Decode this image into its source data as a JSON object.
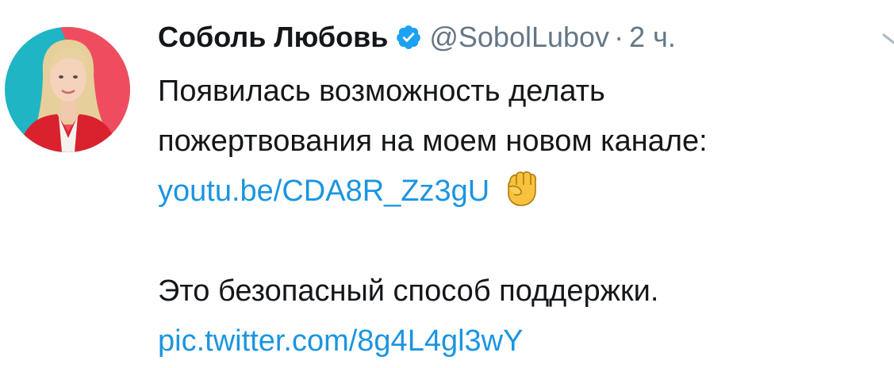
{
  "tweet": {
    "display_name": "Соболь Любовь",
    "handle": "@SobolLubov",
    "separator": "·",
    "time": "2 ч.",
    "text_line1": "Появилась возможность делать",
    "text_line2": "пожертвования на моем новом канале:",
    "link_youtube": "youtu.be/CDA8R_Zz3gU",
    "text_line4": "Это безопасный способ поддержки.",
    "link_pic": "pic.twitter.com/8g4L4gl3wY",
    "emoji": "raised-fist",
    "colors": {
      "link": "#1b95e0",
      "secondary": "#657786",
      "verified": "#1da1f2"
    }
  }
}
